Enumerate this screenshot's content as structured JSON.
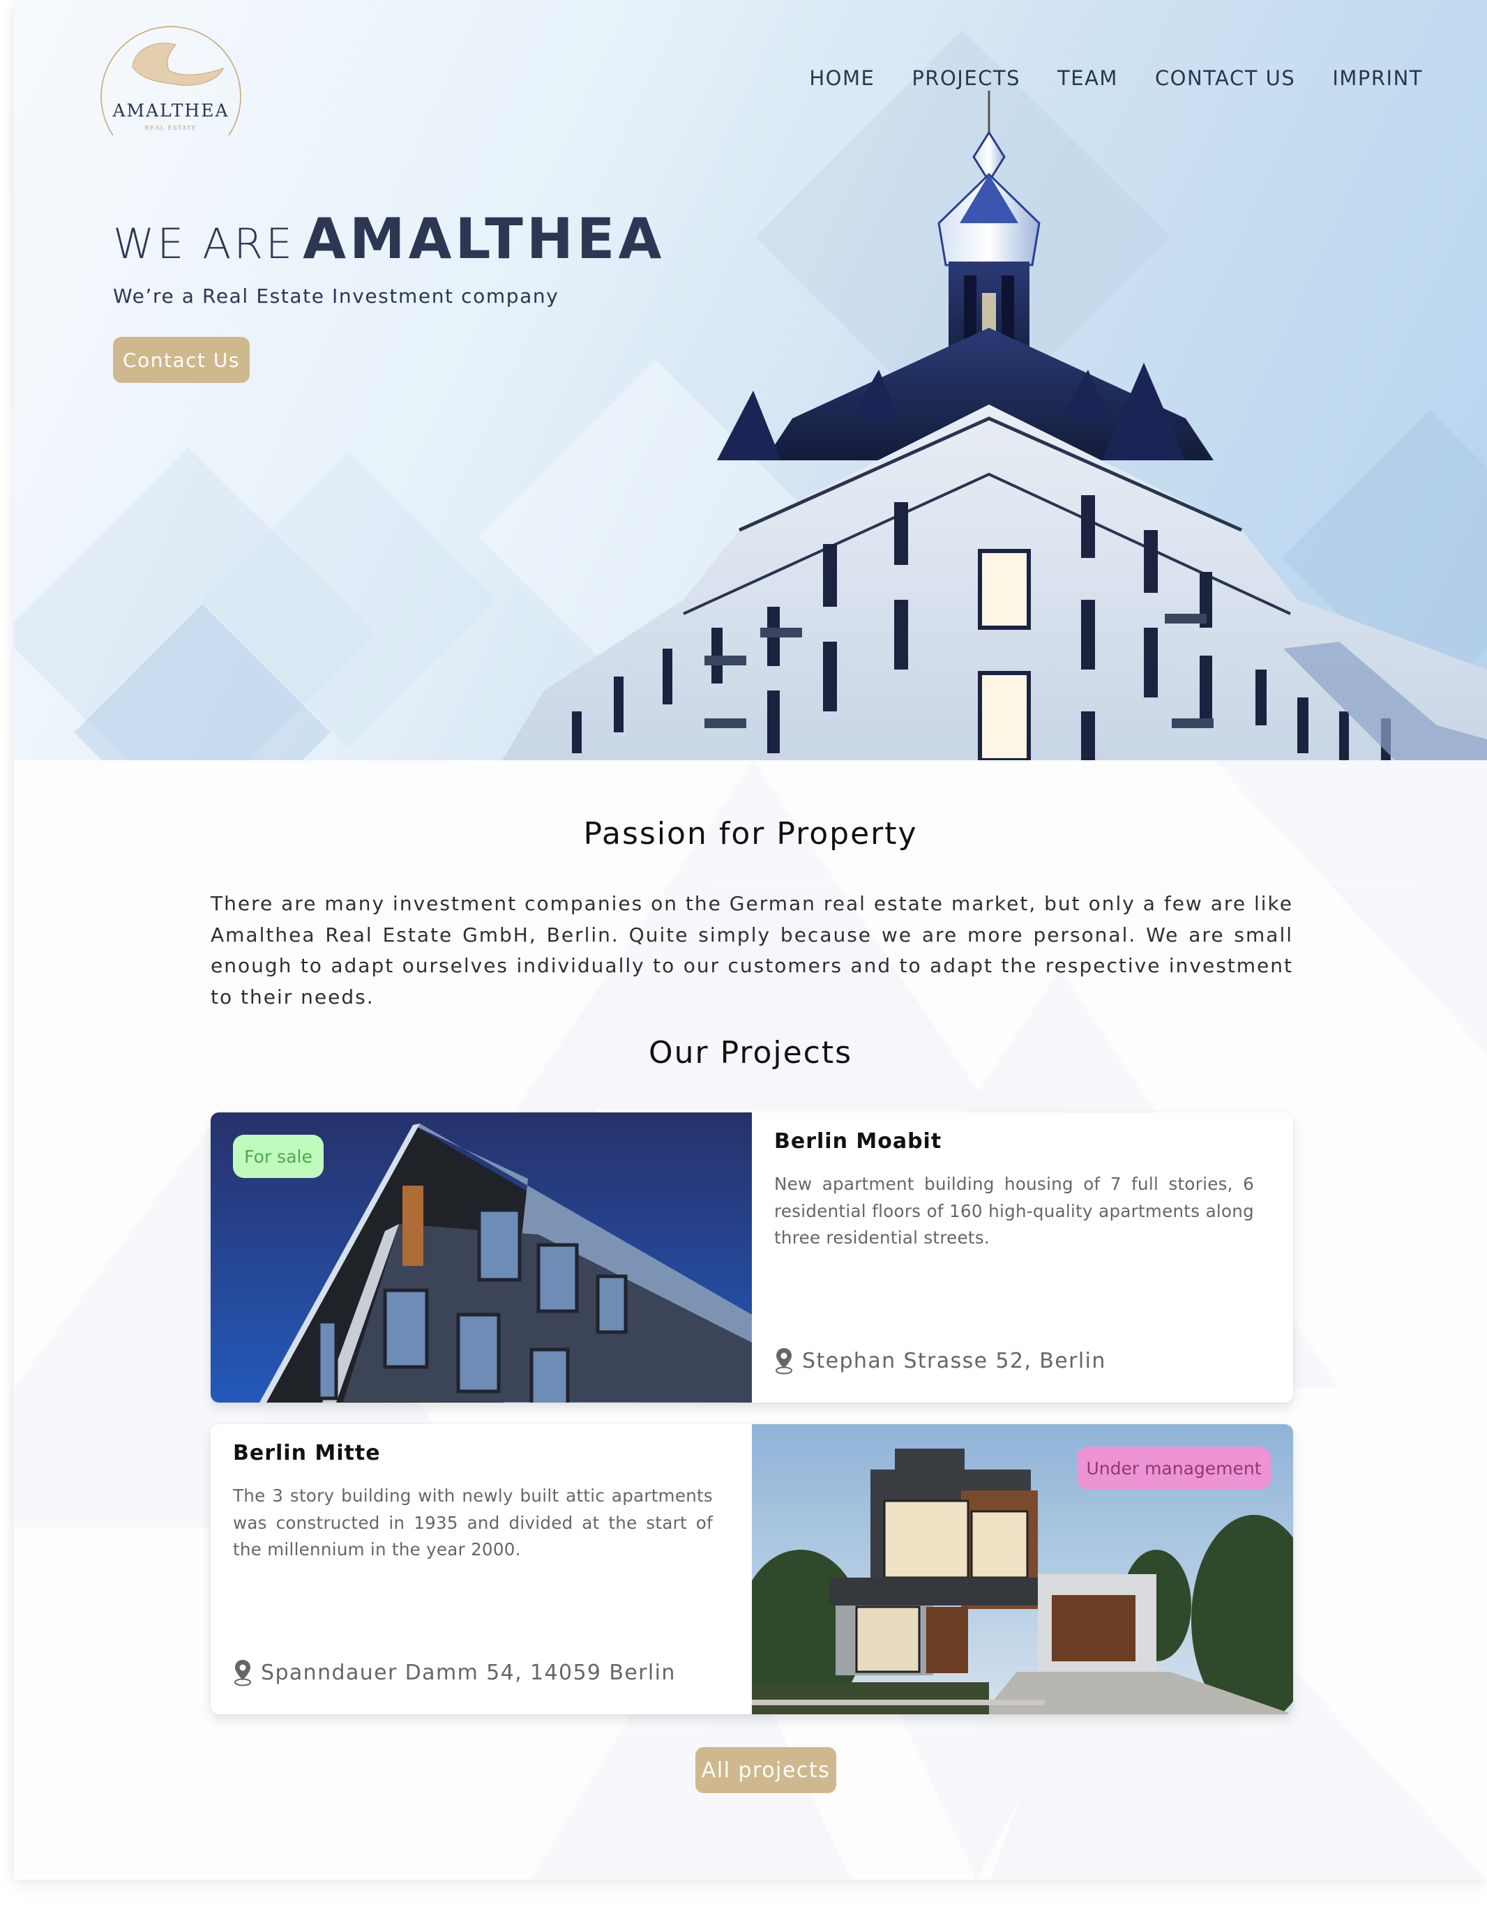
{
  "brand": {
    "logo_name": "AMALTHEA",
    "logo_tagline": "REAL ESTATE"
  },
  "nav": {
    "items": [
      {
        "label": "HOME"
      },
      {
        "label": "PROJECTS"
      },
      {
        "label": "TEAM"
      },
      {
        "label": "CONTACT US"
      },
      {
        "label": "IMPRINT"
      }
    ]
  },
  "hero": {
    "title_prefix": "WE ARE",
    "title_brand": "AMALTHEA",
    "subtitle": "We’re a Real Estate Investment company",
    "cta_label": "Contact Us"
  },
  "about": {
    "heading": "Passion for Property",
    "body": "There are many investment companies on the German real estate market, but only a few are like Amalthea Real Estate GmbH, Berlin. Quite simply because we are more personal. We are small enough to adapt ourselves individually to our customers and to adapt the respective investment to their needs."
  },
  "projects": {
    "heading": "Our Projects",
    "items": [
      {
        "title": "Berlin Moabit",
        "description": "New apartment building housing of 7 full stories, 6 residential floors of 160 high-quality apartments along three residential streets.",
        "address": "Stephan Strasse 52, Berlin",
        "status": "For sale",
        "status_bg": "#c0fbbd",
        "status_fg": "#4fa94c",
        "icon": "map-pin-icon"
      },
      {
        "title": "Berlin Mitte",
        "description": "The 3 story building with newly built attic apartments was constructed in 1935 and divided at the start of the millennium in the year 2000.",
        "address": "Spanndauer Damm 54, 14059 Berlin",
        "status": "Under management",
        "status_bg": "#ee93d3",
        "status_fg": "#8b3d6f",
        "icon": "map-pin-icon"
      }
    ],
    "all_label": "All projects"
  },
  "colors": {
    "accent_gold": "#cfb88d",
    "navy_text": "#2d3753",
    "hero_blue": "#b5d3ee"
  }
}
